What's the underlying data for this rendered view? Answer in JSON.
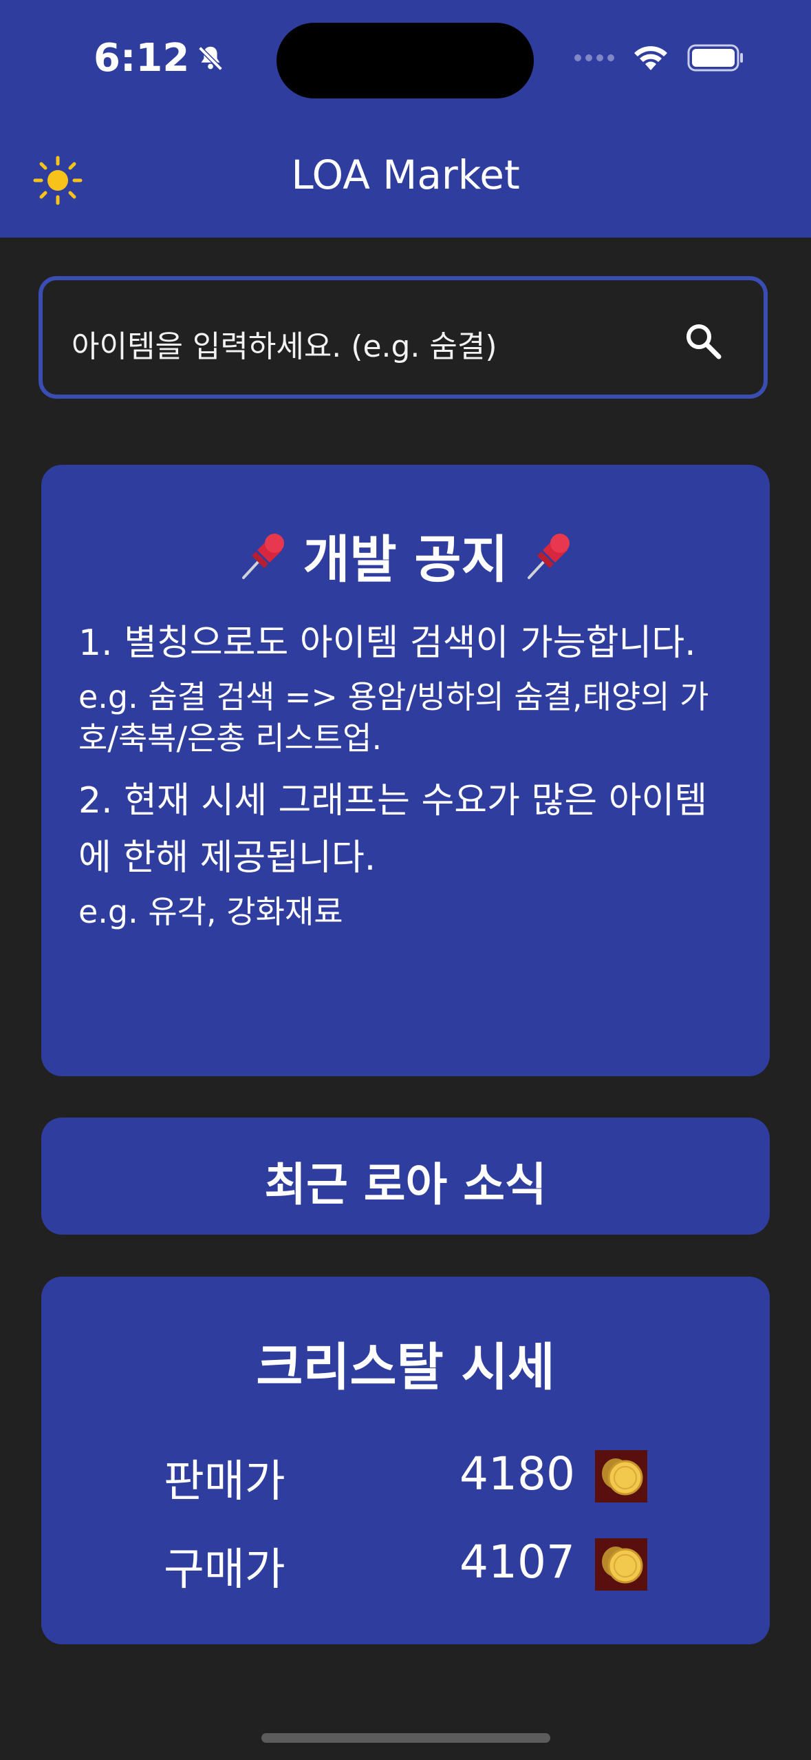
{
  "status_bar": {
    "time": "6:12"
  },
  "app": {
    "title": "LOA Market"
  },
  "search": {
    "placeholder": "아이템을 입력하세요. (e.g. 숨결)"
  },
  "notice": {
    "title": "개발 공지",
    "item1": "1. 별칭으로도 아이템 검색이 가능합니다.",
    "item1_example": "e.g. 숨결 검색 => 용암/빙하의 숨결,태양의 가호/축복/은총 리스트업.",
    "item2": "2. 현재 시세 그래프는 수요가 많은 아이템에 한해 제공됩니다.",
    "item2_example": "e.g. 유각, 강화재료"
  },
  "news": {
    "title": "최근 로아 소식"
  },
  "crystal": {
    "title": "크리스탈 시세",
    "sell_label": "판매가",
    "sell_value": "4180",
    "buy_label": "구매가",
    "buy_value": "4107"
  },
  "colors": {
    "header": "#2f3e9e",
    "background": "#212121",
    "card": "#2f3e9e",
    "search_border": "#3a4db3"
  },
  "icons": [
    "bell-slash-icon",
    "wifi-icon",
    "battery-icon",
    "sun-icon",
    "search-icon",
    "pushpin-icon",
    "gold-coin-icon"
  ]
}
